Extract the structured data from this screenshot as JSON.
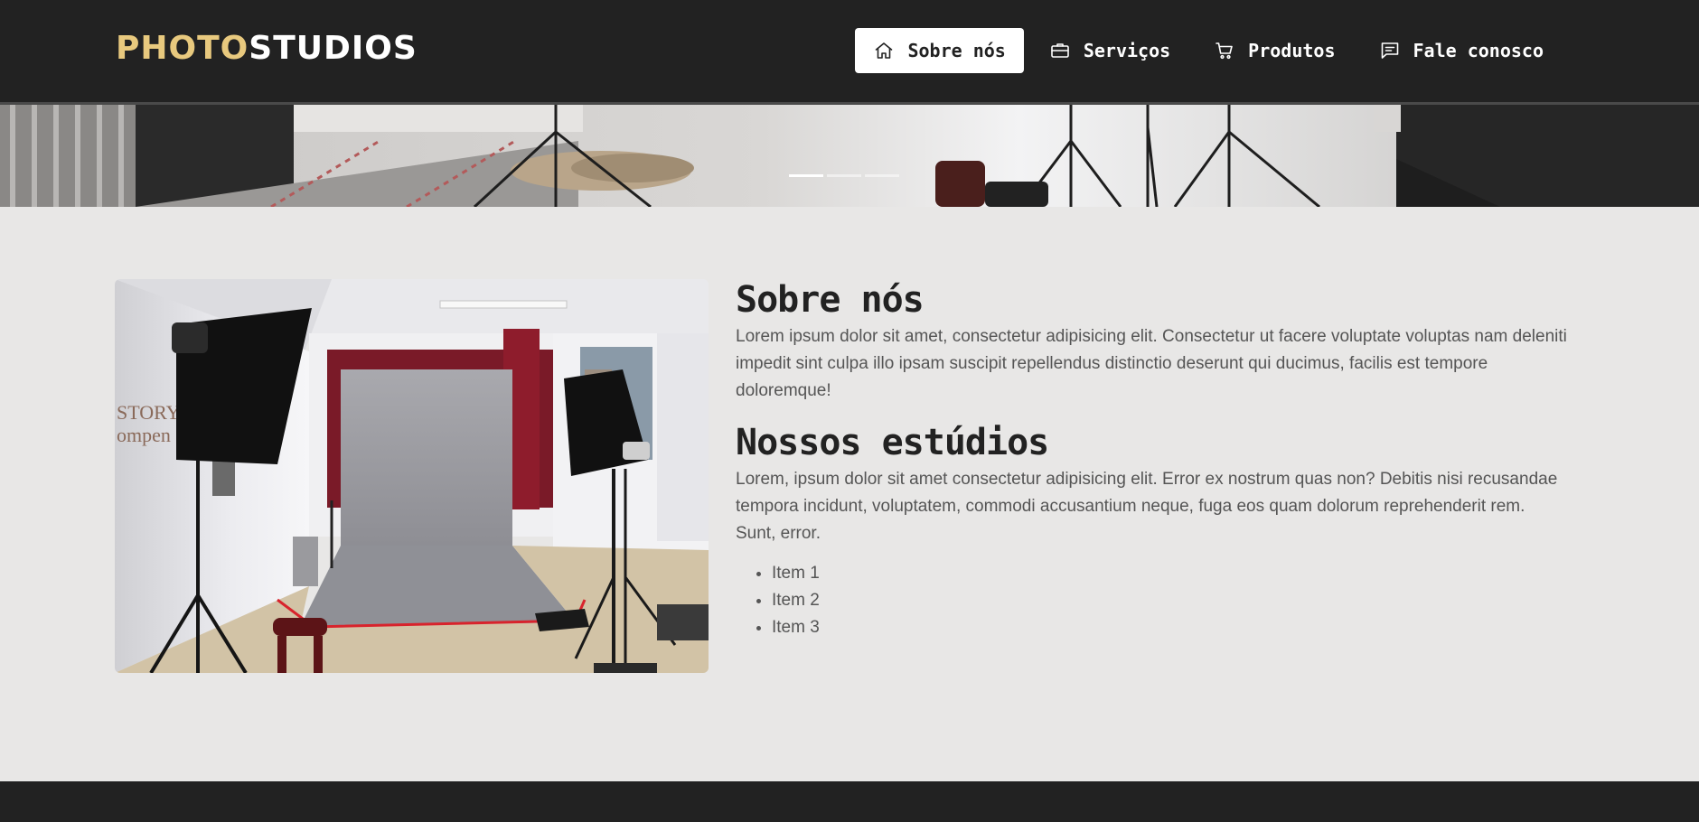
{
  "header": {
    "logo_part1": "PHOTO",
    "logo_part2": "STUDIOS",
    "nav": [
      {
        "label": "Sobre nós",
        "icon": "home-icon",
        "active": true
      },
      {
        "label": "Serviços",
        "icon": "briefcase-icon",
        "active": false
      },
      {
        "label": "Produtos",
        "icon": "cart-icon",
        "active": false
      },
      {
        "label": "Fale conosco",
        "icon": "chat-icon",
        "active": false
      }
    ]
  },
  "hero": {
    "slide_count": 3,
    "active_slide": 1
  },
  "about": {
    "title": "Sobre nós",
    "text": "Lorem ipsum dolor sit amet, consectetur adipisicing elit. Consectetur ut facere voluptate voluptas nam deleniti impedit sint culpa illo ipsam suscipit repellendus distinctio deserunt qui ducimus, facilis est tempore doloremque!"
  },
  "studios": {
    "title": "Nossos estúdios",
    "text": "Lorem, ipsum dolor sit amet consectetur adipisicing elit. Error ex nostrum quas non? Debitis nisi recusandae tempora incidunt, voluptatem, commodi accusantium neque, fuga eos quam dolorum reprehenderit rem. Sunt, error.",
    "items": [
      "Item 1",
      "Item 2",
      "Item 3"
    ]
  },
  "colors": {
    "header_bg": "#222222",
    "logo_accent": "#e8c97e",
    "page_bg": "#e8e7e6",
    "footer_bg": "#222222"
  }
}
